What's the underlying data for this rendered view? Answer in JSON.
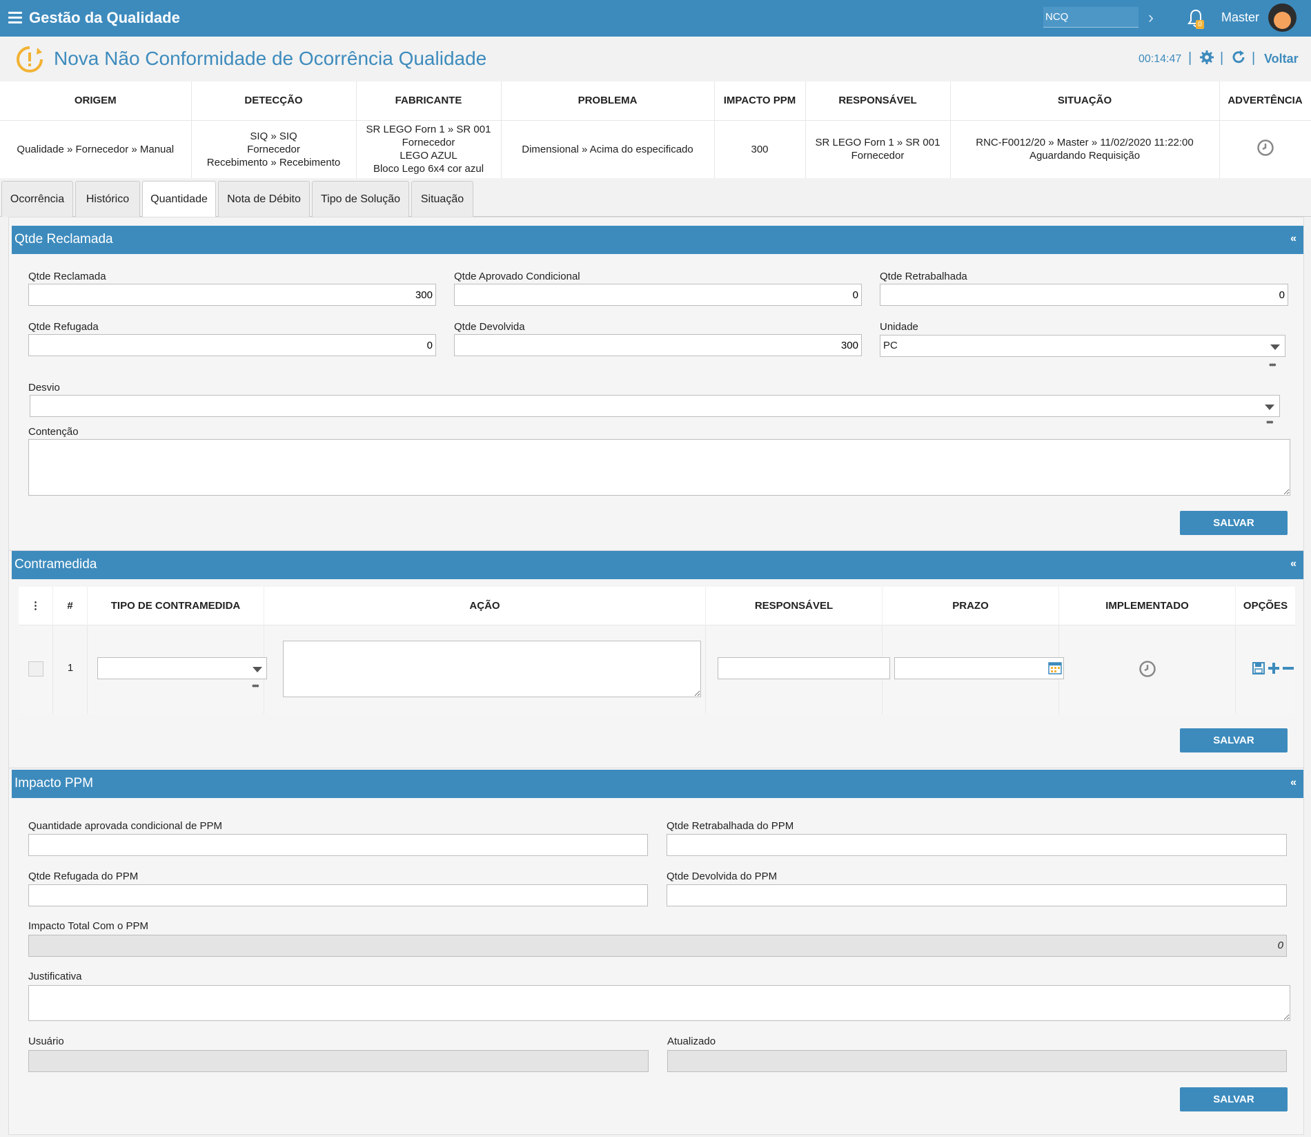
{
  "topbar": {
    "app_title": "Gestão da Qualidade",
    "module_value": "NCQ",
    "notifications_count": "0",
    "user_name": "Master",
    "accent_color": "#3d8bbd"
  },
  "page_header": {
    "title": "Nova Não Conformidade de Ocorrência Qualidade",
    "timer": "00:14:47",
    "sep": "|",
    "back_label": "Voltar"
  },
  "summary": {
    "headers": [
      "ORIGEM",
      "DETECÇÃO",
      "FABRICANTE",
      "PROBLEMA",
      "IMPACTO PPM",
      "RESPONSÁVEL",
      "SITUAÇÃO",
      "ADVERTÊNCIA"
    ],
    "origem": "Qualidade » Fornecedor » Manual",
    "deteccao": [
      "SIQ » SIQ",
      "Fornecedor",
      "Recebimento » Recebimento"
    ],
    "fabricante": [
      "SR LEGO Forn 1 » SR 001",
      "Fornecedor",
      "LEGO AZUL",
      "Bloco Lego 6x4 cor azul"
    ],
    "problema": "Dimensional » Acima do especificado",
    "impacto_ppm": "300",
    "responsavel": [
      "SR LEGO Forn 1 » SR 001",
      "Fornecedor"
    ],
    "situacao": [
      "RNC-F0012/20 » Master » 11/02/2020 11:22:00",
      "Aguardando Requisição"
    ]
  },
  "tabs": [
    "Ocorrência",
    "Histórico",
    "Quantidade",
    "Nota de Débito",
    "Tipo de Solução",
    "Situação"
  ],
  "active_tab": "Quantidade",
  "qtde_reclamada": {
    "title": "Qtde Reclamada",
    "collapse": "«",
    "fields": {
      "reclamada": {
        "label": "Qtde Reclamada",
        "value": "300"
      },
      "aprovado_condicional": {
        "label": "Qtde Aprovado Condicional",
        "value": "0"
      },
      "retrabalhada": {
        "label": "Qtde Retrabalhada",
        "value": "0"
      },
      "refugada": {
        "label": "Qtde Refugada",
        "value": "0"
      },
      "devolvida": {
        "label": "Qtde Devolvida",
        "value": "300"
      },
      "unidade": {
        "label": "Unidade",
        "value": "PC"
      },
      "desvio": {
        "label": "Desvio",
        "value": ""
      },
      "contencao": {
        "label": "Contenção",
        "value": ""
      }
    },
    "save_label": "SALVAR"
  },
  "contramedida": {
    "title": "Contramedida",
    "collapse": "«",
    "headers": {
      "menu": "⋮",
      "num": "#",
      "tipo": "TIPO DE CONTRAMEDIDA",
      "acao": "AÇÃO",
      "responsavel": "RESPONSÁVEL",
      "prazo": "PRAZO",
      "implementado": "IMPLEMENTADO",
      "opcoes": "OPÇÕES"
    },
    "rows": [
      {
        "num": "1",
        "tipo": "",
        "acao": "",
        "responsavel": "",
        "prazo": ""
      }
    ],
    "save_label": "SALVAR"
  },
  "impacto_ppm": {
    "title": "Impacto PPM",
    "collapse": "«",
    "fields": {
      "aprovada_condicional": {
        "label": "Quantidade aprovada condicional de PPM",
        "value": ""
      },
      "retrabalhada": {
        "label": "Qtde Retrabalhada do PPM",
        "value": ""
      },
      "refugada": {
        "label": "Qtde Refugada do PPM",
        "value": ""
      },
      "devolvida": {
        "label": "Qtde Devolvida do PPM",
        "value": ""
      },
      "impacto_total": {
        "label": "Impacto Total Com o PPM",
        "value": "0"
      },
      "justificativa": {
        "label": "Justificativa",
        "value": ""
      },
      "usuario": {
        "label": "Usuário",
        "value": ""
      },
      "atualizado": {
        "label": "Atualizado",
        "value": ""
      }
    },
    "save_label": "SALVAR"
  },
  "dots": "•••"
}
